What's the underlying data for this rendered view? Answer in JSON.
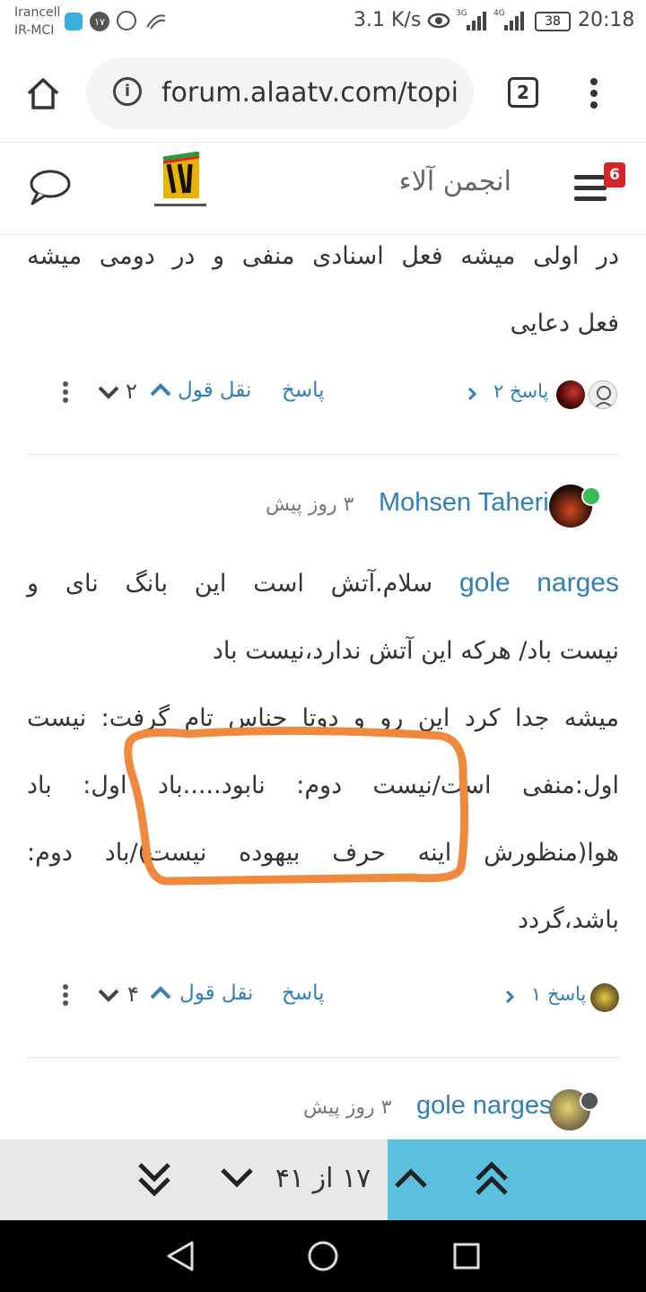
{
  "status": {
    "carrier_line1": "Irancell",
    "carrier_line2": "IR-MCI",
    "badge": "۱۷",
    "speed": "3.1 K/s",
    "net1": "3G",
    "net2": "4G",
    "battery": "38",
    "time": "20:18"
  },
  "browser": {
    "url": "forum.alaatv.com/topic",
    "tab_count": "2"
  },
  "forum": {
    "title": "انجمن آلاء",
    "notification_count": "6"
  },
  "post1": {
    "text_lines": [
      "در اولی میشه فعل اسنادی منفی و در دومی میشه",
      "فعل دعایی"
    ],
    "replies": "۲ پاسخ",
    "reply_label": "پاسخ",
    "quote_label": "نقل قول",
    "votes": "۲"
  },
  "post2": {
    "author": "Mohsen Taheri",
    "time": "۳ روز پیش",
    "mention": "gole narges",
    "line1_rest": "سلام.آتش است این بانگ نای و",
    "line2": "نیست باد/ هرکه این آتش ندارد،نیست باد",
    "line3": "میشه جدا کرد این رو و دوتا جناس تام گرفت: نیست",
    "line4": "اول:منفی است/نیست دوم: نابود.....باد اول: باد",
    "line5": "هوا(منظورش اینه حرف بیهوده نیست)/باد دوم:",
    "line6": "باشد،گردد",
    "replies": "۱ پاسخ",
    "reply_label": "پاسخ",
    "quote_label": "نقل قول",
    "votes": "۴"
  },
  "post3": {
    "author": "gole narges",
    "time": "۳ روز پیش"
  },
  "pager": {
    "position": "۱۷ از ۴۱"
  },
  "colors": {
    "accent_blue": "#2f7fb8",
    "pager_accent": "#5bc0de",
    "highlight": "#f0883e",
    "notif_red": "#d9232a"
  }
}
